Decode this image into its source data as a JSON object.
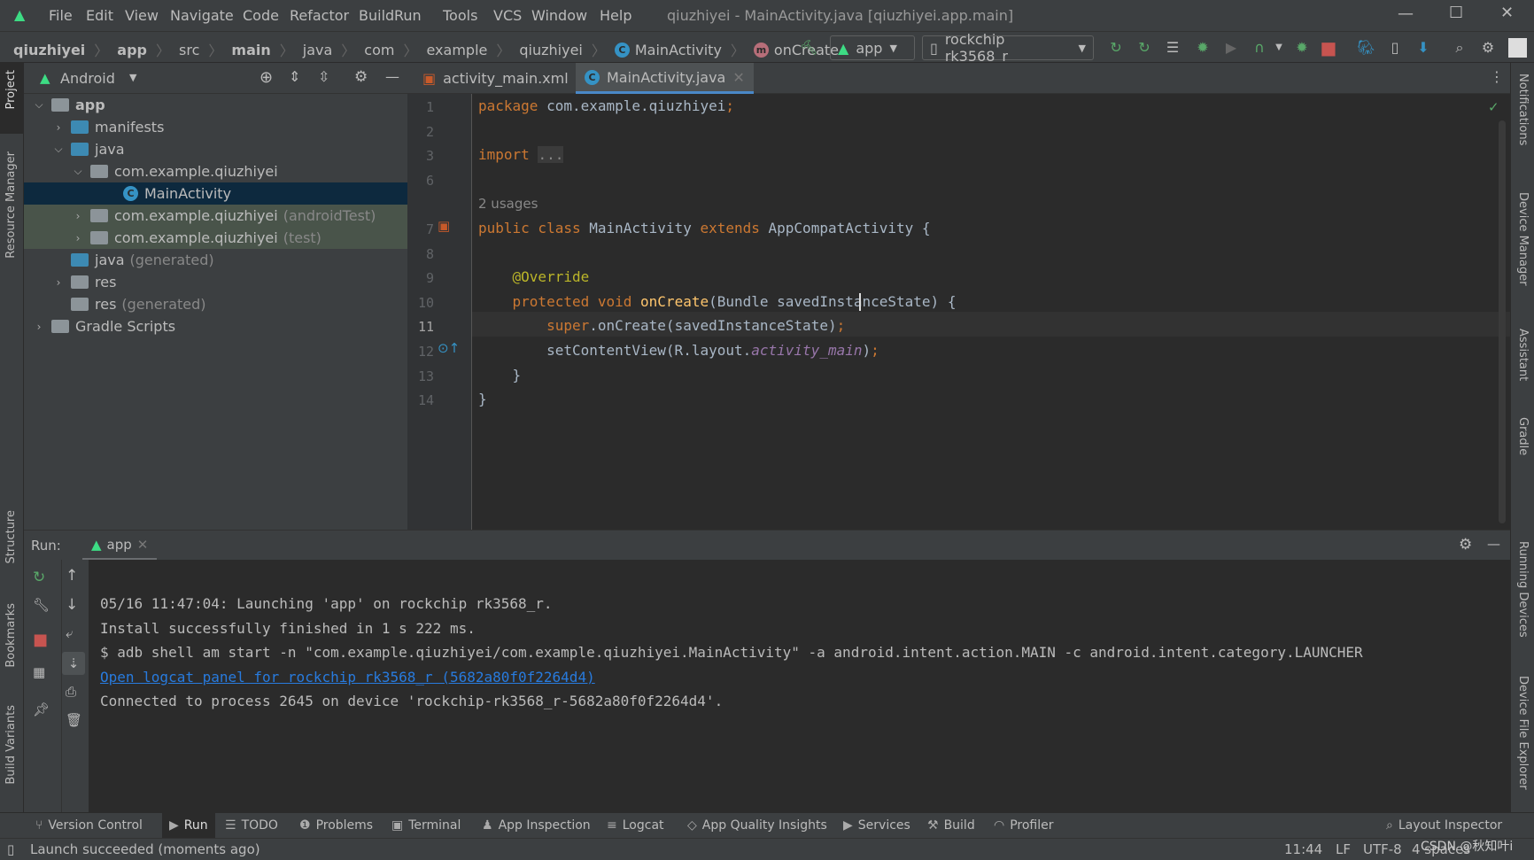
{
  "window": {
    "title": "qiuzhiyei - MainActivity.java [qiuzhiyei.app.main]",
    "menu": [
      "File",
      "Edit",
      "View",
      "Navigate",
      "Code",
      "Refactor",
      "Build",
      "Run",
      "Tools",
      "VCS",
      "Window",
      "Help"
    ]
  },
  "breadcrumb": [
    "qiuzhiyei",
    "app",
    "src",
    "main",
    "java",
    "com",
    "example",
    "qiuzhiyei",
    "MainActivity",
    "onCreate"
  ],
  "toolbar": {
    "run_config": "app",
    "device": "rockchip rk3568_r"
  },
  "left_stripe": [
    "Project",
    "Resource Manager",
    "Structure",
    "Bookmarks",
    "Build Variants"
  ],
  "right_stripe": [
    "Notifications",
    "Device Manager",
    "Assistant",
    "Gradle",
    "Running Devices",
    "Device File Explorer"
  ],
  "project": {
    "view": "Android",
    "tree": [
      {
        "label": "app",
        "suffix": "",
        "depth": 0,
        "expanded": "open",
        "color": "#8c9499"
      },
      {
        "label": "manifests",
        "suffix": "",
        "depth": 1,
        "expanded": "closed",
        "color": "#3d8ab3"
      },
      {
        "label": "java",
        "suffix": "",
        "depth": 1,
        "expanded": "open",
        "color": "#3d8ab3"
      },
      {
        "label": "com.example.qiuzhiyei",
        "suffix": "",
        "depth": 2,
        "expanded": "open",
        "color": "#8c9499"
      },
      {
        "label": "MainActivity",
        "suffix": "",
        "depth": 3,
        "expanded": "none",
        "color": "class",
        "selected": true
      },
      {
        "label": "com.example.qiuzhiyei",
        "suffix": "(androidTest)",
        "depth": 2,
        "expanded": "closed",
        "color": "#8c9499",
        "tinted": true
      },
      {
        "label": "com.example.qiuzhiyei",
        "suffix": "(test)",
        "depth": 2,
        "expanded": "closed",
        "color": "#8c9499",
        "tinted": true
      },
      {
        "label": "java",
        "suffix": "(generated)",
        "depth": 1,
        "expanded": "none",
        "color": "#3d8ab3"
      },
      {
        "label": "res",
        "suffix": "",
        "depth": 1,
        "expanded": "closed",
        "color": "#8c9499"
      },
      {
        "label": "res",
        "suffix": "(generated)",
        "depth": 1,
        "expanded": "none",
        "color": "#8c9499"
      },
      {
        "label": "Gradle Scripts",
        "suffix": "",
        "depth": 0,
        "expanded": "closed",
        "color": "#8c9499"
      }
    ]
  },
  "tabs": [
    {
      "label": "activity_main.xml",
      "active": false
    },
    {
      "label": "MainActivity.java",
      "active": true
    }
  ],
  "editor": {
    "lines": [
      {
        "n": "1",
        "tokens": [
          [
            "package",
            "kw"
          ],
          [
            " com.example.qiuzhiyei",
            ""
          ],
          [
            ";",
            "kw"
          ]
        ]
      },
      {
        "n": "2",
        "tokens": []
      },
      {
        "n": "3",
        "tokens": [
          [
            "import",
            "kw"
          ],
          [
            " ",
            ""
          ],
          [
            "...",
            "fold-dots"
          ]
        ]
      },
      {
        "n": "6",
        "tokens": []
      },
      {
        "n": "",
        "tokens": [
          [
            "2 usages",
            "hint"
          ]
        ]
      },
      {
        "n": "7",
        "tokens": [
          [
            "public class",
            "kw"
          ],
          [
            " MainActivity ",
            ""
          ],
          [
            "extends",
            "kw"
          ],
          [
            " AppCompatActivity {",
            ""
          ]
        ]
      },
      {
        "n": "8",
        "tokens": []
      },
      {
        "n": "9",
        "tokens": [
          [
            "    @Override",
            "ann"
          ]
        ]
      },
      {
        "n": "10",
        "tokens": [
          [
            "    protected void",
            "kw"
          ],
          [
            " ",
            ""
          ],
          [
            "onCreate",
            "fn"
          ],
          [
            "(Bundle savedInstanceState) {",
            ""
          ]
        ]
      },
      {
        "n": "11",
        "tokens": [
          [
            "        super",
            "kw"
          ],
          [
            ".onCreate(savedInstanceState)",
            ""
          ],
          [
            ";",
            "kw"
          ]
        ]
      },
      {
        "n": "12",
        "tokens": [
          [
            "        setContentView(R.layout.",
            ""
          ],
          [
            "activity_main",
            "it"
          ],
          [
            ")",
            ""
          ],
          [
            ";",
            "kw"
          ]
        ]
      },
      {
        "n": "13",
        "tokens": [
          [
            "    }",
            ""
          ]
        ]
      },
      {
        "n": "14",
        "tokens": [
          [
            "}",
            ""
          ]
        ]
      }
    ]
  },
  "run": {
    "label": "Run:",
    "tab": "app",
    "console": [
      {
        "text": "05/16 11:47:04: Launching 'app' on rockchip rk3568_r.",
        "link": false
      },
      {
        "text": "Install successfully finished in 1 s 222 ms.",
        "link": false
      },
      {
        "text": "$ adb shell am start -n \"com.example.qiuzhiyei/com.example.qiuzhiyei.MainActivity\" -a android.intent.action.MAIN -c android.intent.category.LAUNCHER",
        "link": true,
        "plain": true
      },
      {
        "text": "Open logcat panel for rockchip rk3568_r (5682a80f0f2264d4)",
        "link": true
      },
      {
        "text": "Connected to process 2645 on device 'rockchip-rk3568_r-5682a80f0f2264d4'.",
        "link": false
      }
    ]
  },
  "tool_windows": [
    "Version Control",
    "Run",
    "TODO",
    "Problems",
    "Terminal",
    "App Inspection",
    "Logcat",
    "App Quality Insights",
    "Services",
    "Build",
    "Profiler"
  ],
  "layout_inspector": "Layout Inspector",
  "status": {
    "message": "Launch succeeded (moments ago)",
    "position": "11:44",
    "line_sep": "LF",
    "encoding": "UTF-8",
    "indent": "4 spaces",
    "watermark": "CSDN @秋知叶i"
  }
}
